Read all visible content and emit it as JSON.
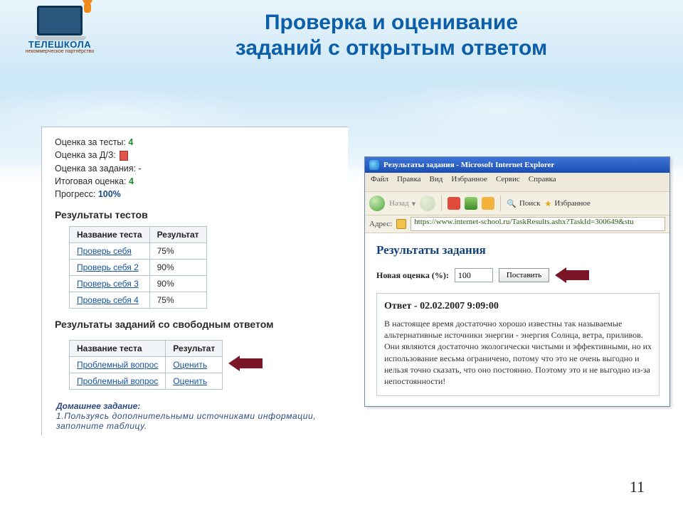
{
  "brand": {
    "name": "ТЕЛЕШКОЛА",
    "sub": "некоммерческое партнёрство"
  },
  "slide": {
    "title_line1": "Проверка и оценивание",
    "title_line2": "заданий с открытым ответом",
    "page_number": "11"
  },
  "panel": {
    "tests_grade_label": "Оценка за тесты:",
    "tests_grade_value": "4",
    "hw_grade_label": "Оценка за Д/З:",
    "tasks_grade_label": "Оценка за задания:",
    "tasks_grade_value": "-",
    "final_grade_label": "Итоговая оценка:",
    "final_grade_value": "4",
    "progress_label": "Прогресс:",
    "progress_value": "100%",
    "tests_section": "Результаты тестов",
    "tests_table": {
      "headers": [
        "Название теста",
        "Результат"
      ],
      "rows": [
        {
          "name": "Проверь себя",
          "result": "75%"
        },
        {
          "name": "Проверь себя 2",
          "result": "90%"
        },
        {
          "name": "Проверь себя 3",
          "result": "90%"
        },
        {
          "name": "Проверь себя 4",
          "result": "75%"
        }
      ]
    },
    "free_section": "Результаты заданий со свободным ответом",
    "free_table": {
      "headers": [
        "Название теста",
        "Результат"
      ],
      "rows": [
        {
          "name": "Проблемный вопрос",
          "result": "Оценить"
        },
        {
          "name": "Проблемный вопрос",
          "result": "Оценить"
        }
      ]
    },
    "homework_label": "Домашнее задание:",
    "homework_text": "1.Пользуясь дополнительными источниками информации, заполните таблицу."
  },
  "browser": {
    "title": "Результаты задания - Microsoft Internet Explorer",
    "menu": [
      "Файл",
      "Правка",
      "Вид",
      "Избранное",
      "Сервис",
      "Справка"
    ],
    "back_label": "Назад",
    "search_label": "Поиск",
    "fav_label": "Избранное",
    "addr_label": "Адрес:",
    "url": "https://www.internet-school.ru/TaskResults.ashx?TaskId=300649&stu",
    "page": {
      "heading": "Результаты задания",
      "score_label": "Новая оценка (%):",
      "score_value": "100",
      "submit": "Поставить",
      "answer_heading": "Ответ - 02.02.2007 9:09:00",
      "answer_text": "В настоящее время достаточно хорошо известны так называемые альтернативные источники энергии - энергия Солнца, ветра, приливов. Они являются достаточно экологически чистыми и эффективными, но их использование весьма ограничено, потому что это не очень выгодно и нельзя точно сказать, что оно постоянно. Поэтому это и не выгодно из-за непостоянности!"
    }
  }
}
